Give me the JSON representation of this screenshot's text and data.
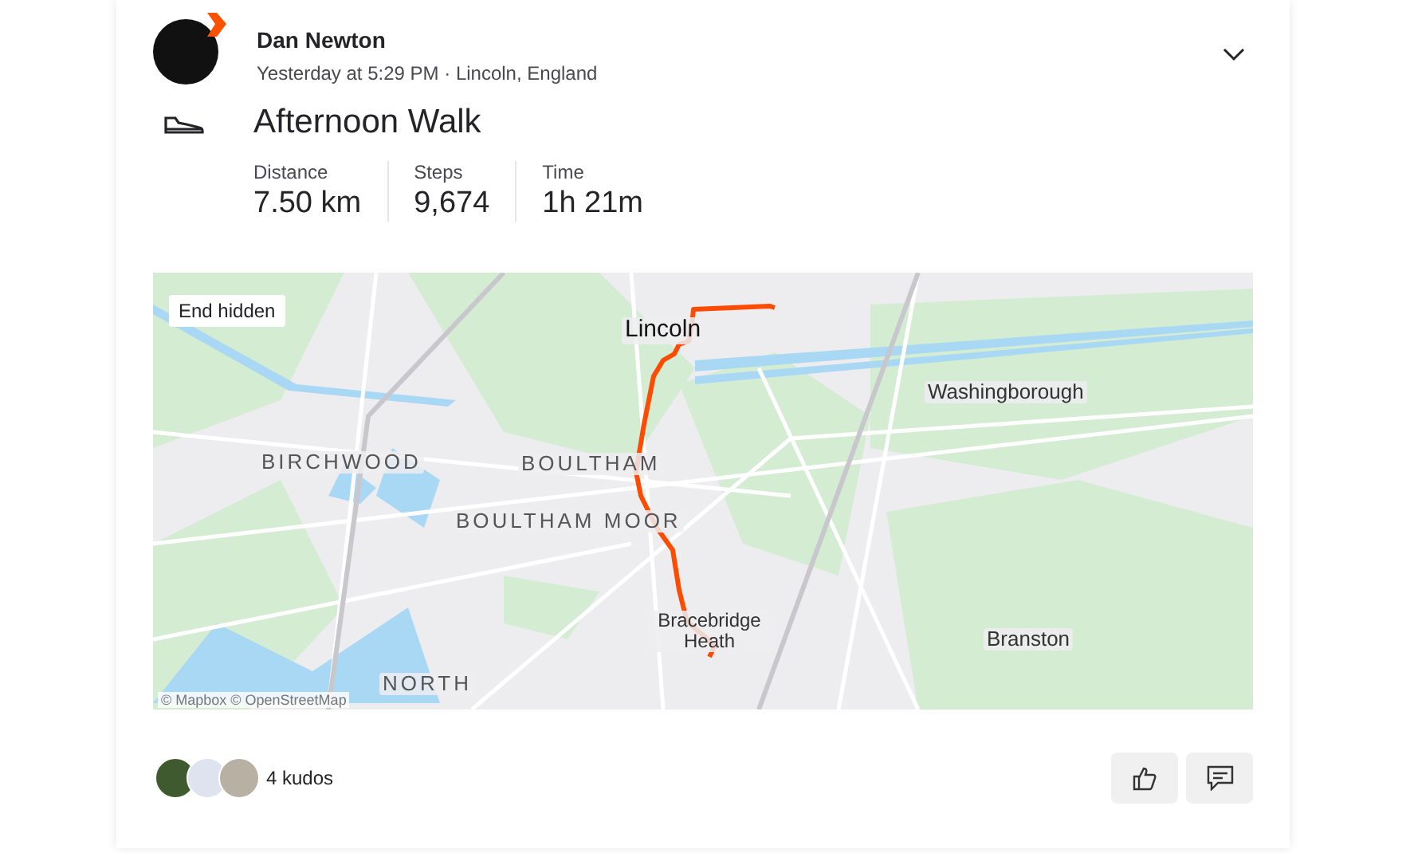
{
  "athlete": {
    "name": "Dan Newton",
    "meta": "Yesterday at 5:29 PM · Lincoln, England"
  },
  "activity": {
    "title": "Afternoon Walk"
  },
  "stats": [
    {
      "label": "Distance",
      "value": "7.50 km"
    },
    {
      "label": "Steps",
      "value": "9,674"
    },
    {
      "label": "Time",
      "value": "1h 21m"
    }
  ],
  "map": {
    "badge": "End hidden",
    "attribution": "© Mapbox © OpenStreetMap",
    "labels": [
      {
        "text": "Lincoln",
        "kind": "city"
      },
      {
        "text": "Washingborough",
        "kind": "town"
      },
      {
        "text": "BIRCHWOOD",
        "kind": "district"
      },
      {
        "text": "BOULTHAM",
        "kind": "district"
      },
      {
        "text": "BOULTHAM MOOR",
        "kind": "district"
      },
      {
        "text": "NORTH",
        "kind": "district"
      },
      {
        "text": "Bracebridge Heath",
        "kind": "town"
      },
      {
        "text": "Branston",
        "kind": "town"
      }
    ]
  },
  "kudos": {
    "count": "4 kudos"
  }
}
